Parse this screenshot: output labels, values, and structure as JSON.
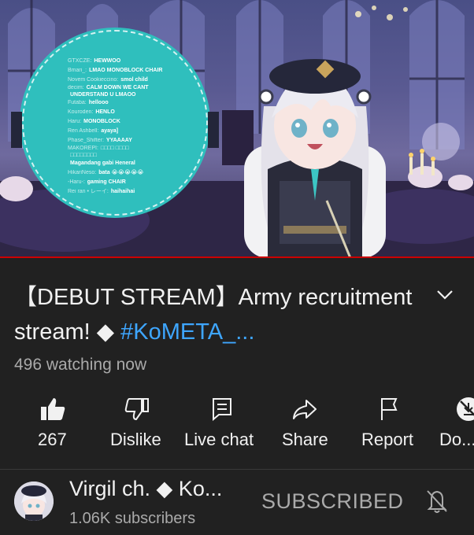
{
  "video": {
    "chat_overlay": [
      {
        "name": "GTXCZE:",
        "msg": "HEWWOO"
      },
      {
        "name": "Bmari_:",
        "msg": "LMAO MONOBLOCK CHAIR"
      },
      {
        "name": "Novem Cookieccino:",
        "msg": "smol child"
      },
      {
        "name": "decim:",
        "msg": "CALM DOWN WE CANT"
      },
      {
        "name": "",
        "msg": "UNDERSTAND U LMAOO"
      },
      {
        "name": "Futaba:",
        "msg": "hellooo"
      },
      {
        "name": "Kouroden:",
        "msg": "HENLO"
      },
      {
        "name": "Haru:",
        "msg": "MONOBLOCK"
      },
      {
        "name": "Ren Ashbell:",
        "msg": "ayaya]"
      },
      {
        "name": "Phase_Shifter:",
        "msg": "YYAAAAY"
      },
      {
        "name": "MAKOREPI:",
        "msg": "□□□□ □□□□"
      },
      {
        "name": "",
        "msg": "□□□□□□□□"
      },
      {
        "name": "",
        "msg": "Magandang gabi Heneral"
      },
      {
        "name": "HikariNeso:",
        "msg": "bata 😭😭😭😭😭"
      },
      {
        "name": "-Haru-:",
        "msg": "gaming CHAIR"
      },
      {
        "name": "Rei ran • レーイ:",
        "msg": "haihaihai"
      }
    ]
  },
  "title": {
    "main": "【DEBUT STREAM】Army recruitment stream! ◆ ",
    "hashtag": "#KoMETA_..."
  },
  "watching": "496 watching now",
  "actions": [
    {
      "icon": "thumbs-up-icon",
      "label": "267"
    },
    {
      "icon": "thumbs-down-icon",
      "label": "Dislike"
    },
    {
      "icon": "live-chat-icon",
      "label": "Live chat"
    },
    {
      "icon": "share-icon",
      "label": "Share"
    },
    {
      "icon": "flag-icon",
      "label": "Report"
    },
    {
      "icon": "download-off-icon",
      "label": "Do..."
    }
  ],
  "channel": {
    "name": "Virgil ch. ◆ Ko...",
    "subscribers": "1.06K subscribers",
    "subscribe_label": "SUBSCRIBED"
  },
  "colors": {
    "background": "#212121",
    "hashtag": "#3ea6ff",
    "progress": "#cc0000",
    "chat_disc": "#2fbfbd"
  }
}
